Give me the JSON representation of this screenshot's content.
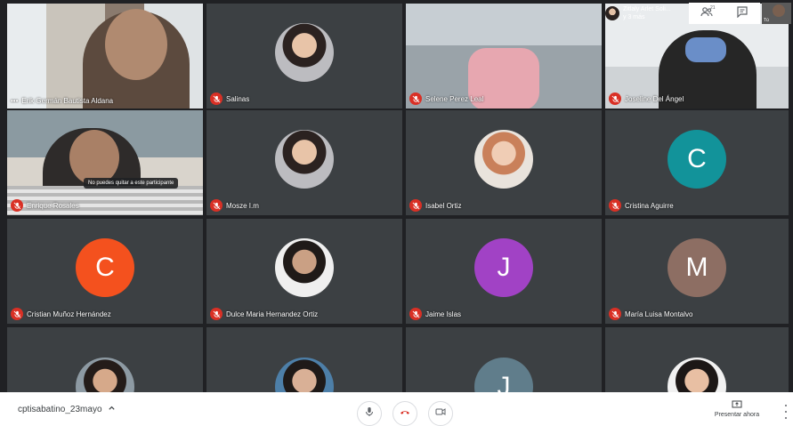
{
  "participants": [
    {
      "name": "Erik Germán Bautista Aldana",
      "prefix": "•••",
      "type": "video",
      "muted": false
    },
    {
      "name": "Salinas",
      "type": "photo",
      "muted": true
    },
    {
      "name": "Selene Perez Leal",
      "type": "video",
      "muted": true
    },
    {
      "name": "Joseline Del Ángel",
      "type": "video",
      "muted": true
    },
    {
      "name": "Enrique Rosales",
      "type": "video",
      "muted": true,
      "tooltip": "No puedes quitar a este participante"
    },
    {
      "name": "Mosze I.m",
      "type": "photo",
      "muted": true
    },
    {
      "name": "Isabel Ortiz",
      "type": "photo",
      "muted": true
    },
    {
      "name": "Cristina Aguirre",
      "type": "letter",
      "letter": "C",
      "color": "#12939a",
      "muted": true
    },
    {
      "name": "Cristian Muñoz Hernández",
      "type": "letter",
      "letter": "C",
      "color": "#f4511e",
      "muted": true
    },
    {
      "name": "Dulce Maria Hernandez Ortiz",
      "type": "photo",
      "muted": true
    },
    {
      "name": "Jaime Islas",
      "type": "letter",
      "letter": "J",
      "color": "#a142c5",
      "muted": true
    },
    {
      "name": "María Luisa Montalvo",
      "type": "letter",
      "letter": "M",
      "color": "#8d6e63",
      "muted": true
    },
    {
      "name": "",
      "type": "photo",
      "muted": true
    },
    {
      "name": "",
      "type": "photo",
      "muted": true
    },
    {
      "name": "",
      "type": "letter",
      "letter": "J",
      "color": "#607d8b",
      "muted": true
    },
    {
      "name": "",
      "type": "photo",
      "muted": true
    }
  ],
  "top_info": {
    "line1": "Zitlaly Arlet Soli...",
    "line2": "y 3 más"
  },
  "top_bar": {
    "people_count": "21",
    "self_label": "Tú"
  },
  "bottom_bar": {
    "meeting_code": "cptisabatino_23mayo",
    "chevron": "^",
    "present_label": "Presentar ahora"
  },
  "colors": {
    "mute": "#d93025",
    "stage_bg": "#202124",
    "tile_bg": "#3c4043"
  },
  "icons": {
    "mic": "mic-icon",
    "hangup": "hangup-icon",
    "camera": "camera-icon",
    "people": "people-icon",
    "chat": "chat-icon",
    "present": "present-icon",
    "more": "more-vert-icon"
  }
}
